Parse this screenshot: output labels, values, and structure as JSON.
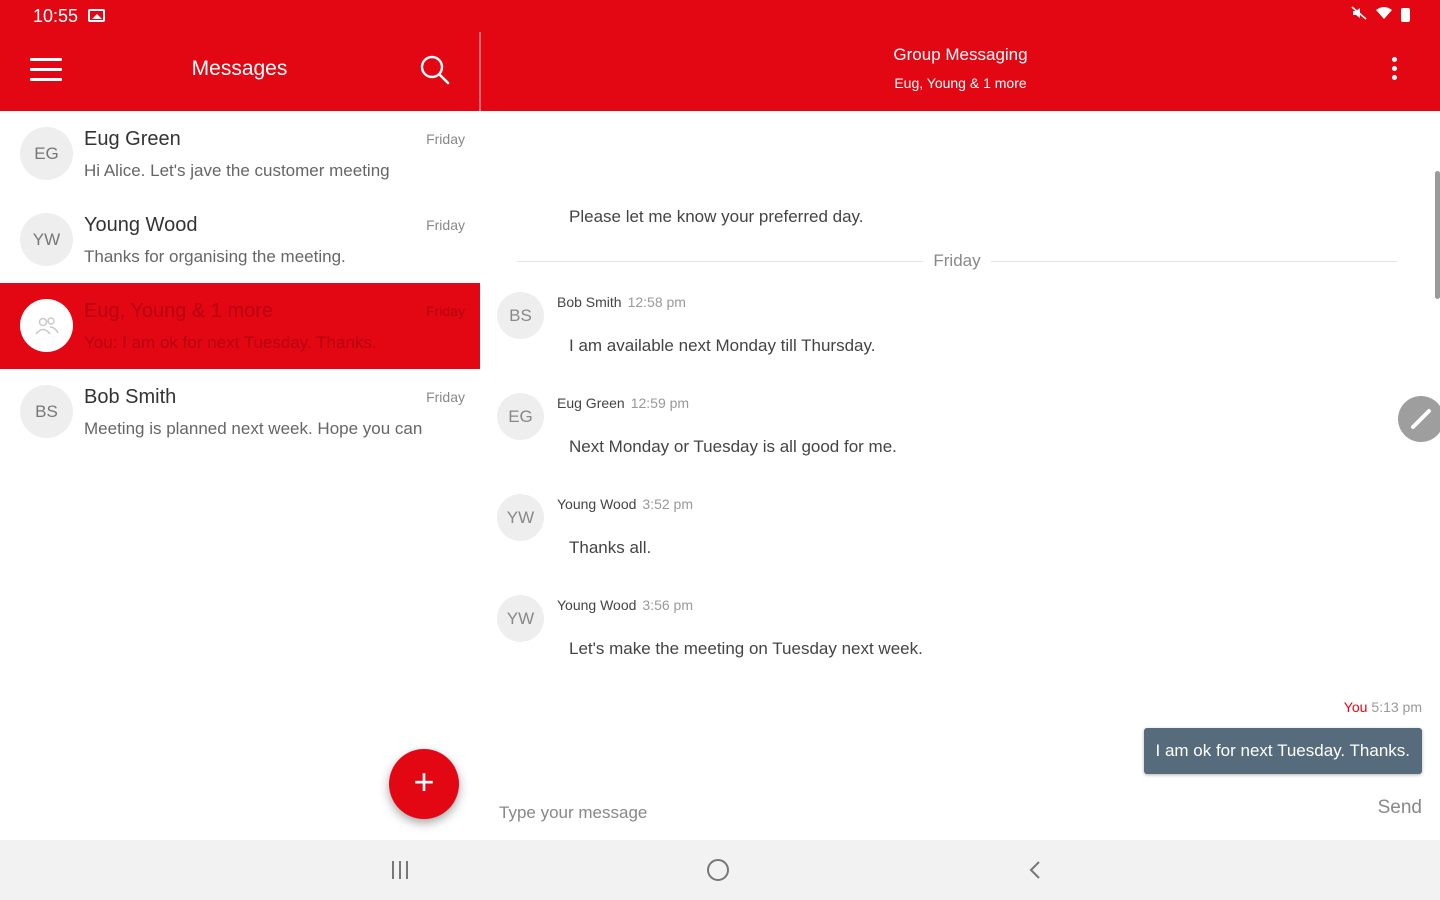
{
  "status_bar": {
    "time": "10:55"
  },
  "left_bar": {
    "title": "Messages"
  },
  "conversation_header": {
    "title": "Group Messaging",
    "subtitle": "Eug, Young & 1 more"
  },
  "conversations": [
    {
      "initials": "EG",
      "name": "Eug Green",
      "date": "Friday",
      "snippet": "Hi Alice. Let's jave the customer meeting"
    },
    {
      "initials": "YW",
      "name": "Young Wood",
      "date": "Friday",
      "snippet": "Thanks for organising the meeting."
    },
    {
      "initials": "",
      "name": "Eug, Young & 1 more",
      "date": "Friday",
      "snippet": "You: I am ok for next Tuesday. Thanks.",
      "active": true
    },
    {
      "initials": "BS",
      "name": "Bob Smith",
      "date": "Friday",
      "snippet": "Meeting is planned next week. Hope you can"
    }
  ],
  "chat": {
    "previous_message": "Please let me know your preferred day.",
    "day_separator": "Friday",
    "messages": [
      {
        "initials": "BS",
        "sender": "Bob Smith",
        "time": "12:58 pm",
        "text": "I am available next Monday till Thursday."
      },
      {
        "initials": "EG",
        "sender": "Eug Green",
        "time": "12:59 pm",
        "text": "Next Monday or Tuesday is all good for me."
      },
      {
        "initials": "YW",
        "sender": "Young Wood",
        "time": "3:52 pm",
        "text": "Thanks all."
      },
      {
        "initials": "YW",
        "sender": "Young Wood",
        "time": "3:56 pm",
        "text": "Let's make the meeting on Tuesday next week."
      }
    ],
    "own_message": {
      "label": "You",
      "time": "5:13 pm",
      "text": "I am ok for next Tuesday. Thanks."
    },
    "input": {
      "placeholder": "Type your message",
      "value": ""
    },
    "send_label": "Send"
  },
  "colors": {
    "brand": "#e30613",
    "own_bubble": "#566b7c",
    "nav_bar": "#f2f2f2"
  },
  "icons": [
    "hamburger-icon",
    "search-icon",
    "more-vert-icon",
    "group-icon",
    "plus-icon",
    "edit-icon",
    "recents-icon",
    "home-icon",
    "back-icon"
  ]
}
